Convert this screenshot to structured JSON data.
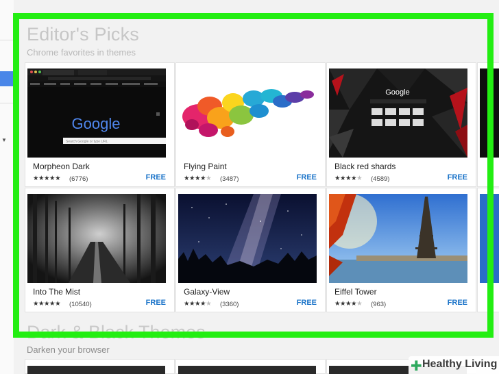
{
  "section": {
    "title": "Editor's Picks",
    "subtitle": "Chrome favorites in themes"
  },
  "section2": {
    "title": "Dark & Black Themes",
    "subtitle": "Darken your browser"
  },
  "themes": [
    {
      "name": "Morpheon Dark",
      "rating": 4.5,
      "stars_text": "★★★★★",
      "count": "(6776)",
      "price": "FREE"
    },
    {
      "name": "Flying Paint",
      "rating": 4,
      "stars_text": "★★★★",
      "count": "(3487)",
      "price": "FREE"
    },
    {
      "name": "Black red shards",
      "rating": 4,
      "stars_text": "★★★★",
      "count": "(4589)",
      "price": "FREE"
    },
    {
      "name": "Into The Mist",
      "rating": 5,
      "stars_text": "★★★★★",
      "count": "(10540)",
      "price": "FREE"
    },
    {
      "name": "Galaxy-View",
      "rating": 4,
      "stars_text": "★★★★",
      "count": "(3360)",
      "price": "FREE"
    },
    {
      "name": "Eiffel Tower",
      "rating": 4,
      "stars_text": "★★★★",
      "count": "(963)",
      "price": "FREE"
    }
  ],
  "morpheon_mock": {
    "logo": "Google",
    "search_placeholder": "Search Google or type URL"
  },
  "shards_mock": {
    "logo": "Google"
  },
  "watermark": {
    "text": "Healthy Living"
  },
  "colors": {
    "highlight": "#23ee12",
    "price": "#1a73c8",
    "sidebar_selected": "#4a86e8"
  }
}
